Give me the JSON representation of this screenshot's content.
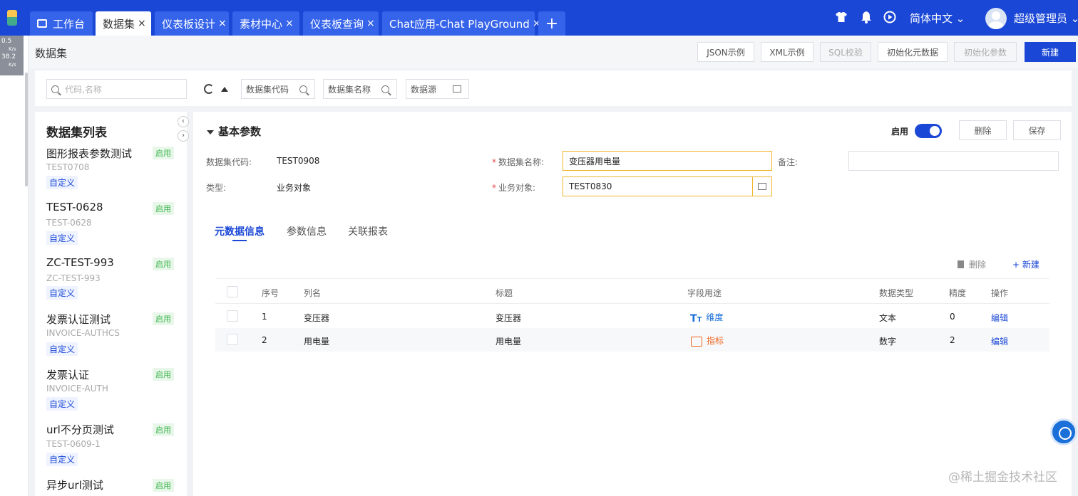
{
  "tabs": [
    {
      "label": "工作台",
      "active": false
    },
    {
      "label": "数据集",
      "active": true
    },
    {
      "label": "仪表板设计",
      "active": false
    },
    {
      "label": "素材中心",
      "active": false
    },
    {
      "label": "仪表板查询",
      "active": false
    },
    {
      "label": "Chat应用-Chat PlayGround",
      "active": false
    }
  ],
  "close_glyph": "×",
  "plus_glyph": "+",
  "header": {
    "language": "简体中文 ⌄",
    "user": "超级管理员 ⌄"
  },
  "perf": {
    "a": "0.5",
    "b": "38.2",
    "unit": "K/s"
  },
  "breadcrumb": "数据集",
  "toolbar": {
    "json": "JSON示例",
    "xml": "XML示例",
    "sql": "SQL校验",
    "init_meta": "初始化元数据",
    "init_param": "初始化参数",
    "new": "新建"
  },
  "filters": {
    "search_placeholder": "代码,名称",
    "code": "数据集代码",
    "name": "数据集名称",
    "source": "数据源"
  },
  "list": {
    "title": "数据集列表",
    "items": [
      {
        "name": "图形报表参数测试",
        "code": "TEST0708",
        "type": "自定义",
        "status": "启用"
      },
      {
        "name": "TEST-0628",
        "code": "TEST-0628",
        "type": "自定义",
        "status": "启用"
      },
      {
        "name": "ZC-TEST-993",
        "code": "ZC-TEST-993",
        "type": "自定义",
        "status": "启用"
      },
      {
        "name": "发票认证测试",
        "code": "INVOICE-AUTHCS",
        "type": "自定义",
        "status": "启用"
      },
      {
        "name": "发票认证",
        "code": "INVOICE-AUTH",
        "type": "自定义",
        "status": "启用"
      },
      {
        "name": "url不分页测试",
        "code": "TEST-0609-1",
        "type": "自定义",
        "status": "启用"
      },
      {
        "name": "异步url测试",
        "code": "",
        "type": "",
        "status": "启用"
      }
    ]
  },
  "form": {
    "section": "基本参数",
    "enable_label": "启用",
    "enabled": true,
    "delete": "删除",
    "save": "保存",
    "code_label": "数据集代码:",
    "code_value": "TEST0908",
    "name_label": "数据集名称:",
    "name_value": "变压器用电量",
    "remark_label": "备注:",
    "remark_value": "",
    "type_label": "类型:",
    "type_value": "业务对象",
    "bo_label": "业务对象:",
    "bo_value": "TEST0830"
  },
  "subtabs": [
    "元数据信息",
    "参数信息",
    "关联报表"
  ],
  "table": {
    "delete": "删除",
    "new": "+ 新建",
    "headers": [
      "序号",
      "列名",
      "标题",
      "字段用途",
      "数据类型",
      "精度",
      "操作"
    ],
    "rows": [
      {
        "seq": "1",
        "column": "变压器",
        "title": "变压器",
        "usage": "维度",
        "dtype": "文本",
        "precision": "0",
        "action": "编辑"
      },
      {
        "seq": "2",
        "column": "用电量",
        "title": "用电量",
        "usage": "指标",
        "dtype": "数字",
        "precision": "2",
        "action": "编辑"
      }
    ]
  },
  "watermark": "@稀土掘金技术社区",
  "colors": {
    "primary": "#1a47d6",
    "success": "#3bb54a",
    "warning": "#f0b429",
    "metric": "#f0641e"
  }
}
